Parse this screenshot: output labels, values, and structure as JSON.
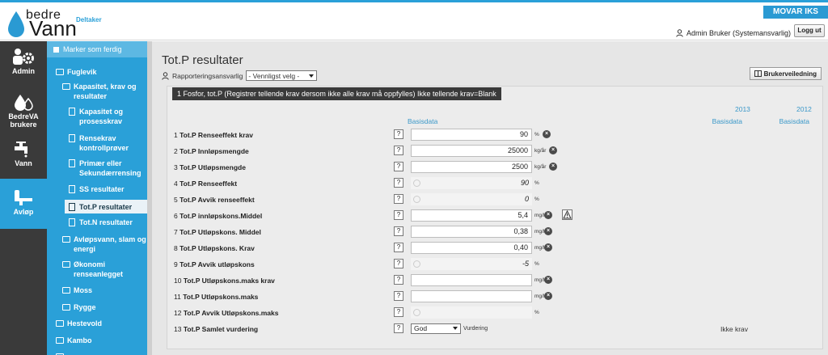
{
  "header": {
    "logo_word1": "bedre",
    "logo_word2": "Vann",
    "role": "Deltaker",
    "org": "MOVAR IKS",
    "user": "Admin Bruker (Systemansvarlig)",
    "logout": "Logg ut"
  },
  "rail": [
    {
      "label": "Admin",
      "icon": "admin-gear-icon"
    },
    {
      "label": "BedreVA brukere",
      "icon": "users-drop-icon"
    },
    {
      "label": "Vann",
      "icon": "water-tap-icon"
    },
    {
      "label": "Avløp",
      "icon": "sink-drain-icon"
    }
  ],
  "tree": {
    "mark_done": "Marker som ferdig",
    "items": [
      {
        "label": "Fuglevik",
        "kind": "folder"
      },
      {
        "label": "Kapasitet, krav og resultater",
        "kind": "folder"
      },
      {
        "label": "Kapasitet og prosesskrav",
        "kind": "doc"
      },
      {
        "label": "Rensekrav kontrollprøver",
        "kind": "doc"
      },
      {
        "label": "Primær eller Sekundærrensing",
        "kind": "doc"
      },
      {
        "label": "SS resultater",
        "kind": "doc"
      },
      {
        "label": "Tot.P resultater",
        "kind": "doc"
      },
      {
        "label": "Tot.N resultater",
        "kind": "doc"
      },
      {
        "label": "Avløpsvann, slam og energi",
        "kind": "folder"
      },
      {
        "label": "Økonomi renseanlegget",
        "kind": "folder"
      },
      {
        "label": "Moss",
        "kind": "folder"
      },
      {
        "label": "Rygge",
        "kind": "folder"
      },
      {
        "label": "Hestevold",
        "kind": "folder"
      },
      {
        "label": "Kambo",
        "kind": "folder"
      }
    ]
  },
  "page": {
    "title": "Tot.P resultater",
    "resp_label": "Rapporteringsansvarlig",
    "resp_value": "- Vennligst velg -",
    "guide": "Brukerveiledning",
    "section": "1  Fosfor, tot.P (Registrer tellende krav dersom ikke alle krav må oppfylles) Ikke tellende krav=Blank",
    "col_basis": "Basisdata",
    "col_2013_year": "2013",
    "col_2013_label": "Basisdata",
    "col_2012_year": "2012",
    "col_2012_label": "Basisdata"
  },
  "rows": [
    {
      "num": "1",
      "label": "Tot.P Renseeffekt krav",
      "value": "90",
      "unit": "%"
    },
    {
      "num": "2",
      "label": "Tot.P Innløpsmengde",
      "value": "25000",
      "unit": "kg/år"
    },
    {
      "num": "3",
      "label": "Tot.P Utløpsmengde",
      "value": "2500",
      "unit": "kg/år"
    },
    {
      "num": "4",
      "label": "Tot.P Renseeffekt",
      "value": "90",
      "unit": "%"
    },
    {
      "num": "5",
      "label": "Tot.P Avvik renseeffekt",
      "value": "0",
      "unit": "%"
    },
    {
      "num": "6",
      "label": "Tot.P innløpskons.Middel",
      "value": "5,4",
      "unit": "mg/l"
    },
    {
      "num": "7",
      "label": "Tot.P Utløpskons. Middel",
      "value": "0,38",
      "unit": "mg/l"
    },
    {
      "num": "8",
      "label": "Tot.P Utløpskons. Krav",
      "value": "0,40",
      "unit": "mg/l"
    },
    {
      "num": "9",
      "label": "Tot.P Avvik utløpskons",
      "value": "-5",
      "unit": "%"
    },
    {
      "num": "10",
      "label": "Tot.P Utløpskons.maks krav",
      "value": "",
      "unit": "mg/l"
    },
    {
      "num": "11",
      "label": "Tot.P Utløpskons.maks",
      "value": "",
      "unit": "mg/l"
    },
    {
      "num": "12",
      "label": "Tot.P Avvik Utløpskons.maks",
      "value": "",
      "unit": "%"
    },
    {
      "num": "13",
      "label": "Tot.P Samlet vurdering",
      "value": "God",
      "unit": "Vurdering",
      "extra": "Ikke krav"
    }
  ],
  "colors": {
    "accent": "#2aa0d8",
    "rail": "#3a3a3a",
    "content_bg": "#e6e6e6"
  }
}
